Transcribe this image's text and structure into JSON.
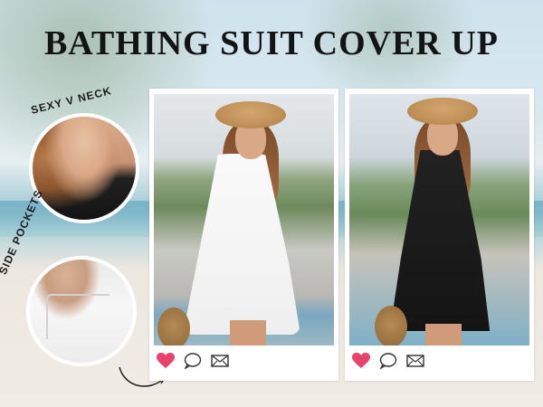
{
  "title": "BATHING SUIT COVER UP",
  "callouts": [
    {
      "label": "SEXY V NECK"
    },
    {
      "label": "SIDE POCKETS"
    }
  ],
  "cards": [
    {
      "dress_color": "white",
      "icons": [
        "heart-icon",
        "comment-icon",
        "mail-icon"
      ]
    },
    {
      "dress_color": "black",
      "icons": [
        "heart-icon",
        "comment-icon",
        "mail-icon"
      ]
    }
  ],
  "colors": {
    "heart": "#e8436b",
    "title": "#141414"
  }
}
